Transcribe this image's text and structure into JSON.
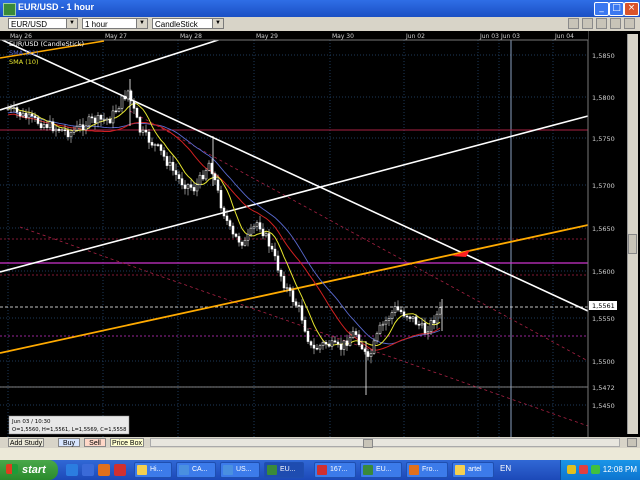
{
  "window": {
    "title": "EUR/USD - 1 hour"
  },
  "toolbar": {
    "symbol": "EUR/USD",
    "interval": "1 hour",
    "chart_style": "CandleStick"
  },
  "legend": {
    "symbol_label": "EUR/USD (CandleStick)",
    "sma_slow": "SMA (21)",
    "sma_fast": "SMA (10)"
  },
  "date_labels": [
    "May 26",
    "May 27",
    "May 28",
    "May 29",
    "May 30",
    "Jun 02",
    "Jun 03",
    "Jun 03",
    "Jun 04"
  ],
  "price_labels": [
    "1,5850",
    "1,5800",
    "1,5750",
    "1,5700",
    "1,5650",
    "1,5600",
    "1,5550",
    "1,5500",
    "1,5472",
    "1,5450"
  ],
  "current_price": "1,5561",
  "info_box": {
    "time": "Jun 03 / 10:30",
    "ohlc": "O=1,5560, H=1,5561, L=1,5569, C=1,5558"
  },
  "bottom_buttons": {
    "add_study": "Add Study",
    "buy": "Buy",
    "sell": "Sell",
    "price_box": "Price Box"
  },
  "taskbar": {
    "start": "start",
    "tasks": [
      "Hi...",
      "CA...",
      "US...",
      "EU...",
      "167...",
      "EU...",
      "Fro...",
      "artel"
    ],
    "language": "EN",
    "clock": "12:08 PM"
  },
  "colors": {
    "background": "#000000",
    "bull_candle": "#ffffff",
    "bear_candle": "#ffffff",
    "sma_fast": "#e6e62e",
    "sma_slow": "#d02020",
    "sma_extra": "#5a6ad0",
    "trendline_white": "#ffffff",
    "trendline_orange": "#ffaa00",
    "horizontal_magenta": "#cc33cc",
    "horizontal_red": "#aa2244"
  },
  "icons": [
    "chart-app-icon",
    "minimize-icon",
    "maximize-icon",
    "close-icon",
    "windows-flag-icon"
  ]
}
